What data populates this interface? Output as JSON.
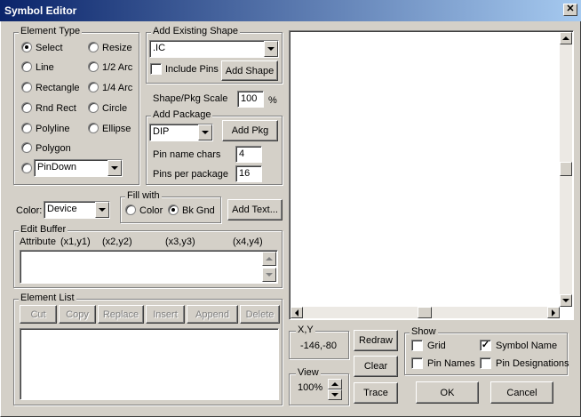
{
  "window": {
    "title": "Symbol Editor",
    "close_glyph": "✕"
  },
  "element_type": {
    "label": "Element Type",
    "left": [
      "Select",
      "Line",
      "Rectangle",
      "Rnd Rect",
      "Polyline",
      "Polygon"
    ],
    "right": [
      "Resize",
      "1/2 Arc",
      "1/4 Arc",
      "Circle",
      "Ellipse"
    ],
    "selected": "Select",
    "pin_combo": "PinDown"
  },
  "add_existing_shape": {
    "label": "Add Existing Shape",
    "shape_combo": ".IC",
    "include_pins_label": "Include Pins",
    "include_pins_checked": false,
    "add_shape_button": "Add Shape"
  },
  "scale": {
    "label": "Shape/Pkg Scale",
    "value": "100",
    "unit": "%"
  },
  "add_package": {
    "label": "Add Package",
    "pkg_combo": "DIP",
    "add_pkg_button": "Add Pkg",
    "pin_name_chars_label": "Pin name chars",
    "pin_name_chars_value": "4",
    "pins_per_package_label": "Pins per package",
    "pins_per_package_value": "16"
  },
  "color": {
    "label": "Color:",
    "combo": "Device"
  },
  "fill_with": {
    "label": "Fill with",
    "color_label": "Color",
    "bkgnd_label": "Bk Gnd",
    "selected": "Bk Gnd"
  },
  "add_text_button": "Add Text...",
  "edit_buffer": {
    "label": "Edit Buffer",
    "header": {
      "attribute": "Attribute",
      "c1": "(x1,y1)",
      "c2": "(x2,y2)",
      "c3": "(x3,y3)",
      "c4": "(x4,y4)"
    }
  },
  "element_list": {
    "label": "Element List",
    "buttons": [
      "Cut",
      "Copy",
      "Replace",
      "Insert",
      "Append",
      "Delete"
    ]
  },
  "xy": {
    "label": "X,Y",
    "value": "-146,-80"
  },
  "view": {
    "label": "View",
    "value": "100%"
  },
  "buttons": {
    "redraw": "Redraw",
    "clear": "Clear",
    "trace": "Trace",
    "ok": "OK",
    "cancel": "Cancel"
  },
  "show": {
    "label": "Show",
    "grid": {
      "label": "Grid",
      "checked": false
    },
    "symbol_name": {
      "label": "Symbol Name",
      "checked": true
    },
    "pin_names": {
      "label": "Pin Names",
      "checked": false
    },
    "pin_designations": {
      "label": "Pin Designations",
      "checked": false
    }
  }
}
